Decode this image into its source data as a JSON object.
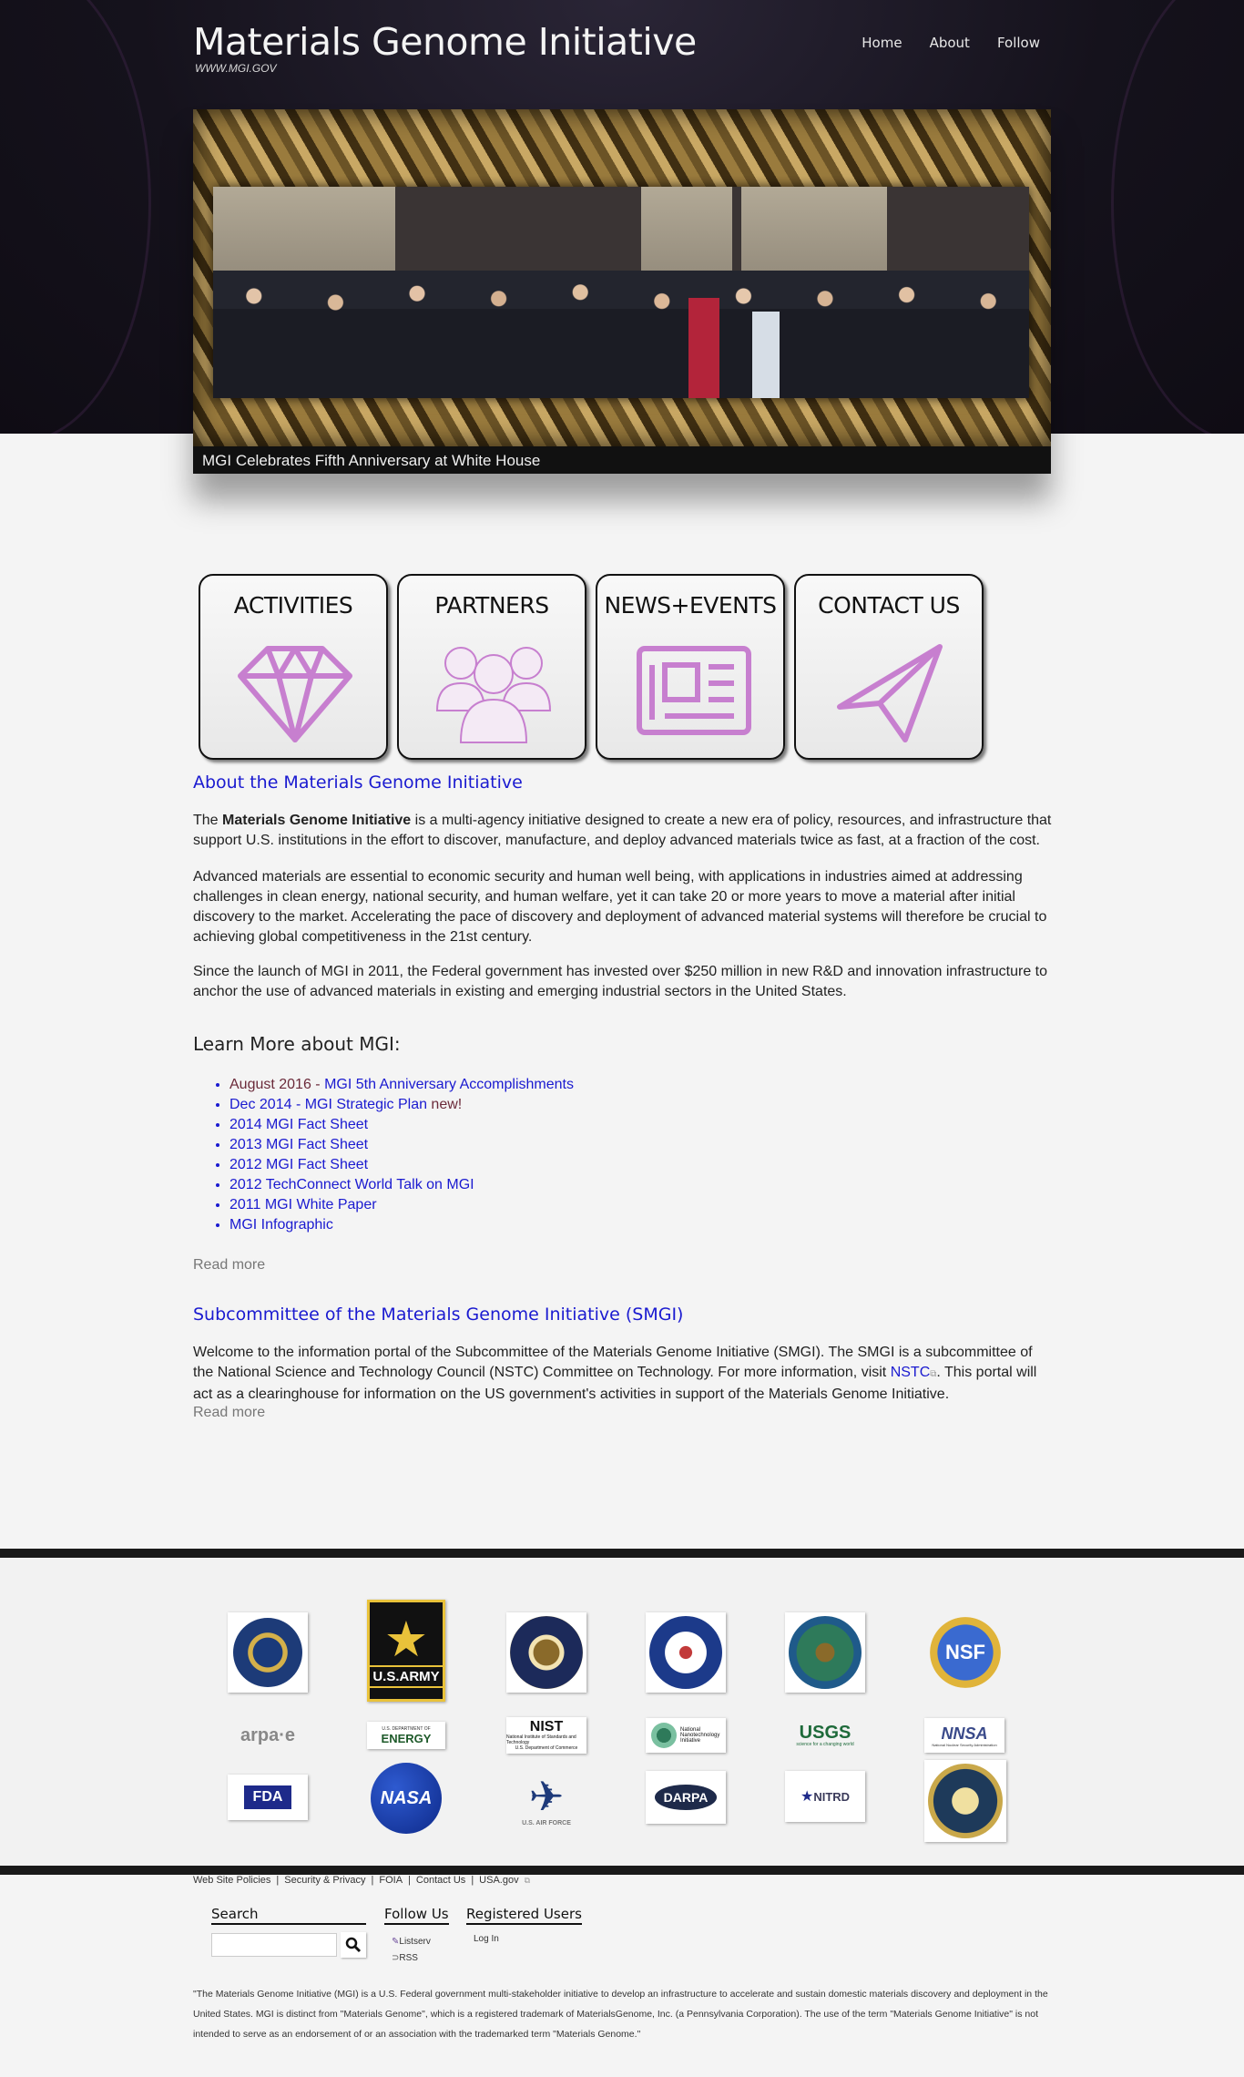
{
  "header": {
    "site_title": "Materials Genome Initiative",
    "site_url": "WWW.MGI.GOV",
    "nav": [
      "Home",
      "About",
      "Follow"
    ]
  },
  "slideshow": {
    "caption": "MGI Celebrates Fifth Anniversary at White House"
  },
  "tiles": [
    {
      "label": "ACTIVITIES",
      "icon": "diamond-icon"
    },
    {
      "label": "PARTNERS",
      "icon": "people-icon"
    },
    {
      "label": "NEWS+EVENTS",
      "icon": "newspaper-icon"
    },
    {
      "label": "CONTACT US",
      "icon": "paper-plane-icon"
    }
  ],
  "about": {
    "title": "About the Materials Genome Initiative",
    "p1_pre": "The ",
    "p1_bold": "Materials Genome Initiative",
    "p1_post": " is a multi-agency initiative designed to create a new era of policy, resources, and infrastructure that support U.S. institutions in the effort to discover, manufacture, and deploy advanced materials twice as fast, at a fraction of the cost.",
    "p2": "Advanced materials are essential to economic security and human well being, with applications in industries aimed at addressing challenges in clean energy, national security, and human welfare, yet it can take 20 or more years to move a material after initial discovery to the market. Accelerating the pace of discovery and deployment of advanced material systems will therefore be crucial to achieving global competitiveness in the 21st century.",
    "p3": "Since the launch of MGI in 2011, the Federal government has invested over $250 million in new R&D and innovation infrastructure to anchor the use of advanced materials in existing and emerging industrial sectors in the United States."
  },
  "learn_more": {
    "title": "Learn More about MGI:",
    "item1_date": "August 2016 - ",
    "item1_link": "MGI 5th Anniversary Accomplishments",
    "item2_link": "Dec 2014 - MGI Strategic Plan",
    "item2_suffix": " new!",
    "items": [
      "2014 MGI Fact Sheet",
      "2013 MGI Fact Sheet",
      "2012 MGI Fact Sheet",
      "2012 TechConnect World Talk on MGI",
      "2011 MGI White Paper",
      "MGI Infographic"
    ],
    "read_more": "Read more"
  },
  "smgi": {
    "title": "Subcommittee of the Materials Genome Initiative (SMGI)",
    "text_pre": "Welcome to the information portal of the Subcommittee of the Materials Genome Initiative (SMGI). The SMGI is a subcommittee of the National Science and Technology Council (NSTC) Committee on Technology. For more information, visit ",
    "link": "NSTC",
    "text_post": ". This portal will act as a clearinghouse for information on the US government's activities in support of the Materials Genome Initiative.",
    "read_more": "Read more"
  },
  "partners": {
    "army_text": "U.S.ARMY",
    "arpae": "arpa·e",
    "energy": "ENERGY",
    "energy_small": "U.S. DEPARTMENT OF",
    "nist": "NIST",
    "nist_sub": "National Institute of Standards and Technology",
    "nist_sub2": "U.S. Department of Commerce",
    "nni": "National Nanotechnology Initiative",
    "usgs": "USGS",
    "usgs_sub": "science for a changing world",
    "nnsa": "NNSA",
    "nnsa_sub": "National Nuclear Security Administration",
    "nsf": "NSF",
    "fda": "FDA",
    "nasa": "NASA",
    "airforce": "U.S. AIR FORCE",
    "darpa": "DARPA",
    "nitrd": "NITRD"
  },
  "footer": {
    "links": [
      "Web Site Policies",
      "Security & Privacy",
      "FOIA",
      "Contact Us",
      "USA.gov"
    ],
    "search_title": "Search",
    "follow_title": "Follow Us",
    "follow_items": [
      "Listserv",
      "RSS"
    ],
    "registered_title": "Registered Users",
    "login": "Log In",
    "disclaimer": "\"The Materials Genome Initiative (MGI) is a U.S. Federal government multi-stakeholder initiative to develop an infrastructure to accelerate and sustain domestic materials discovery and deployment in the United States. MGI is distinct from \"Materials Genome\", which is a registered trademark of MaterialsGenome, Inc. (a Pennsylvania Corporation). The use of the term \"Materials Genome Initiative\" is not intended to serve as an endorsement of or an association with the trademarked term \"Materials Genome.\""
  }
}
